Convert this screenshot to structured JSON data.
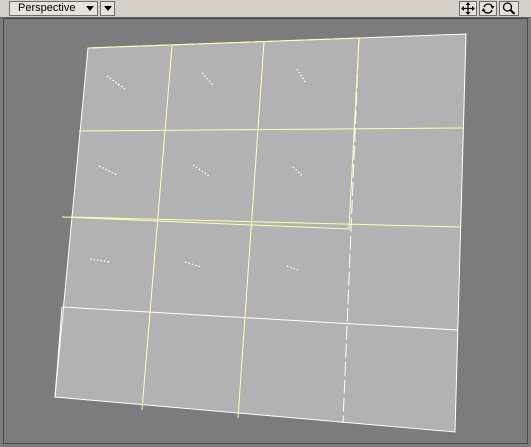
{
  "toolbar": {
    "view_mode": "Perspective",
    "icons": {
      "dropdown": "chevron-down-icon",
      "options": "chevron-down-icon",
      "move": "move-arrows-icon",
      "rotate": "rotate-icon",
      "zoom": "zoom-icon"
    }
  },
  "viewport": {
    "background_color": "#7c7c7c",
    "plane_color": "#b2b2b2",
    "edge_color": "#ffffff",
    "selected_edge_color": "#ffffb0",
    "grid_rows": 4,
    "grid_cols": 4
  }
}
